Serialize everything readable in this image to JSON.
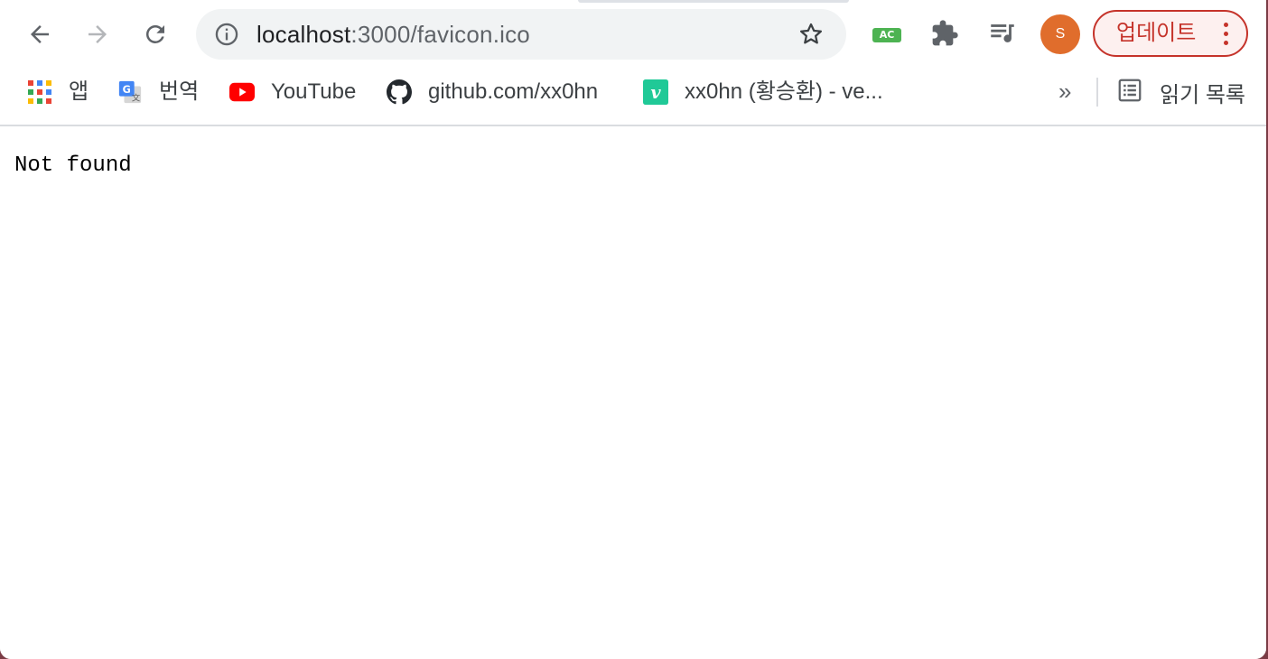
{
  "toolbar": {
    "back_icon": "arrow-left-icon",
    "forward_icon": "arrow-right-icon",
    "reload_icon": "reload-icon",
    "omnibox": {
      "info_icon": "info-icon",
      "host": "localhost",
      "path": ":3000/favicon.ico",
      "bookmark_icon": "star-icon"
    },
    "extensions": [
      {
        "name": "ac-extension",
        "label": "AC"
      },
      {
        "name": "extensions-puzzle",
        "icon": "puzzle-icon"
      },
      {
        "name": "media-control",
        "icon": "playlist-music-icon"
      }
    ],
    "profile_initial": "S",
    "update_label": "업데이트",
    "colors": {
      "accent_red": "#c5332a",
      "avatar": "#e06d2c",
      "ac_badge": "#4db352"
    }
  },
  "bookmarks": {
    "items": [
      {
        "label": "앱",
        "icon": "apps-grid-icon"
      },
      {
        "label": "번역",
        "icon": "google-translate-icon"
      },
      {
        "label": "YouTube",
        "icon": "youtube-icon"
      },
      {
        "label": "github.com/xx0hn",
        "icon": "github-icon"
      },
      {
        "label": "xx0hn (황승환) - ve...",
        "icon": "velog-icon"
      }
    ],
    "overflow": "»",
    "reading_list": "읽기 목록"
  },
  "page": {
    "body_text": "Not found"
  }
}
